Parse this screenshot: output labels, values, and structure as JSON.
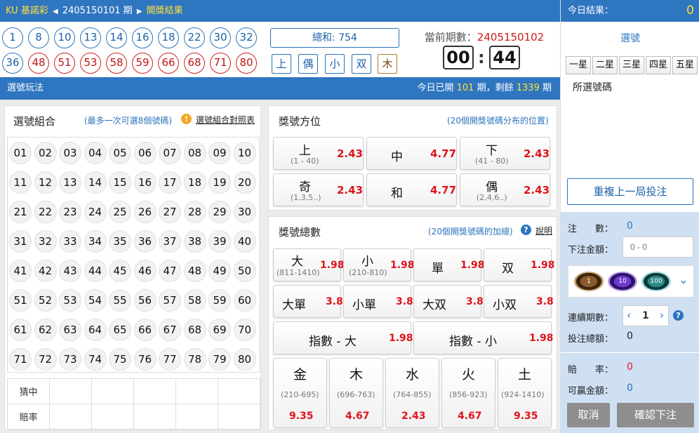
{
  "header": {
    "brand": "KU 基諾彩",
    "period": "2405150101",
    "period_suffix": "期",
    "result_link": "開獎結果"
  },
  "result_balls": {
    "row1": [
      "1",
      "8",
      "10",
      "13",
      "14",
      "16",
      "18",
      "22",
      "30",
      "32"
    ],
    "row2": [
      "36",
      "48",
      "51",
      "53",
      "58",
      "59",
      "66",
      "68",
      "71",
      "80"
    ]
  },
  "summary": {
    "sum": "總和: 754",
    "tags": [
      "上",
      "偶",
      "小",
      "双",
      "木"
    ]
  },
  "draw": {
    "label": "當前期數：",
    "current": "2405150102",
    "minutes": "00",
    "sep": ":",
    "seconds": "44"
  },
  "bar": {
    "left": "選號玩法",
    "prefix": "今日已開",
    "opened": "101",
    "mid": "期，剩餘",
    "remaining": "1339",
    "suffix": "期"
  },
  "pick": {
    "title": "選號組合",
    "hint": "(最多一次可選8個號碼)",
    "warn_icon": "!",
    "link": "選號組合對照表",
    "numbers": [
      "01",
      "02",
      "03",
      "04",
      "05",
      "06",
      "07",
      "08",
      "09",
      "10",
      "11",
      "12",
      "13",
      "14",
      "15",
      "16",
      "17",
      "18",
      "19",
      "20",
      "21",
      "22",
      "23",
      "24",
      "25",
      "26",
      "27",
      "28",
      "29",
      "30",
      "31",
      "32",
      "33",
      "34",
      "35",
      "36",
      "37",
      "38",
      "39",
      "40",
      "41",
      "42",
      "43",
      "44",
      "45",
      "46",
      "47",
      "48",
      "49",
      "50",
      "51",
      "52",
      "53",
      "54",
      "55",
      "56",
      "57",
      "58",
      "59",
      "60",
      "61",
      "62",
      "63",
      "64",
      "65",
      "66",
      "67",
      "68",
      "69",
      "70",
      "71",
      "72",
      "73",
      "74",
      "75",
      "76",
      "77",
      "78",
      "79",
      "80"
    ],
    "guess_label": "猜中",
    "odds_label": "賠率"
  },
  "position": {
    "title": "獎號方位",
    "hint": "(20個開獎號碼分布的位置)",
    "items": [
      {
        "name": "上",
        "range": "(1 - 40)",
        "odds": "2.43"
      },
      {
        "name": "中",
        "range": "",
        "odds": "4.77"
      },
      {
        "name": "下",
        "range": "(41 - 80)",
        "odds": "2.43"
      },
      {
        "name": "奇",
        "range": "(1,3,5..)",
        "odds": "2.43"
      },
      {
        "name": "和",
        "range": "",
        "odds": "4.77"
      },
      {
        "name": "偶",
        "range": "(2,4,6..)",
        "odds": "2.43"
      }
    ]
  },
  "total": {
    "title": "獎號總數",
    "hint": "(20個開獎號碼的加總)",
    "help": "?",
    "link": "說明",
    "row1": [
      {
        "name": "大",
        "range": "(811-1410)",
        "odds": "1.98"
      },
      {
        "name": "小",
        "range": "(210-810)",
        "odds": "1.98"
      },
      {
        "name": "單",
        "range": "",
        "odds": "1.98"
      },
      {
        "name": "双",
        "range": "",
        "odds": "1.98"
      }
    ],
    "row2": [
      {
        "name": "大單",
        "odds": "3.8"
      },
      {
        "name": "小單",
        "odds": "3.8"
      },
      {
        "name": "大双",
        "odds": "3.8"
      },
      {
        "name": "小双",
        "odds": "3.8"
      }
    ],
    "row3": [
      {
        "name": "指數 - 大",
        "odds": "1.98"
      },
      {
        "name": "指數 - 小",
        "odds": "1.98"
      }
    ],
    "row4": [
      {
        "name": "金",
        "range": "(210-695)",
        "odds": "9.35"
      },
      {
        "name": "木",
        "range": "(696-763)",
        "odds": "4.67"
      },
      {
        "name": "水",
        "range": "(764-855)",
        "odds": "2.43"
      },
      {
        "name": "火",
        "range": "(856-923)",
        "odds": "4.67"
      },
      {
        "name": "土",
        "range": "(924-1410)",
        "odds": "9.35"
      }
    ]
  },
  "right": {
    "today_label": "今日結果：",
    "today_value": "0",
    "picked_title": "選號",
    "star_tabs": [
      "一星",
      "二星",
      "三星",
      "四星",
      "五星"
    ],
    "selected_label": "所選號碼",
    "repeat": "重複上一局投注",
    "bets_label": "注　　數：",
    "bets_value": "0",
    "amount_label": "下注金額：",
    "amount_placeholder": "0 - 0",
    "chips": [
      "1",
      "10",
      "100"
    ],
    "consec_label": "連續期數：",
    "consec_value": "1",
    "consec_help": "?",
    "total_label": "投注總額：",
    "total_value": "0",
    "rate_label": "賠　　率：",
    "rate_value": "0",
    "win_label": "可贏金額：",
    "win_value": "0",
    "cancel": "取消",
    "confirm": "確認下注"
  },
  "colors": {
    "primary": "#2f76c0",
    "red": "#e0131b",
    "accent_yellow": "#ffe03a"
  }
}
